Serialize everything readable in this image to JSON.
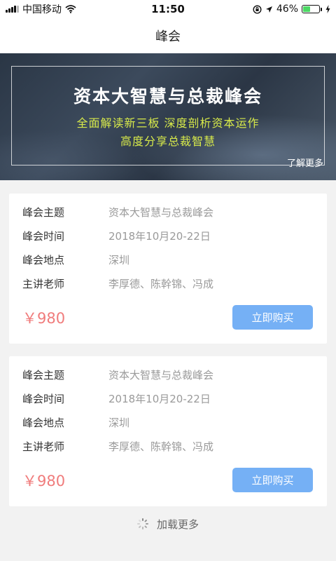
{
  "status_bar": {
    "carrier": "中国移动",
    "time": "11:50",
    "battery_percent": "46%",
    "battery_level": 0.46,
    "icons": [
      "signal-icon",
      "wifi-icon",
      "rotation-lock-icon",
      "location-icon",
      "battery-icon",
      "charging-icon"
    ]
  },
  "nav": {
    "title": "峰会"
  },
  "banner": {
    "title": "资本大智慧与总裁峰会",
    "subtitle_line1": "全面解读新三板  深度剖析资本运作",
    "subtitle_line2": "高度分享总裁智慧",
    "more_label": "了解更多",
    "accent_color": "#d7e94a"
  },
  "cards": [
    {
      "rows": [
        {
          "label": "峰会主题",
          "value": "资本大智慧与总裁峰会"
        },
        {
          "label": "峰会时间",
          "value": "2018年10月20-22日"
        },
        {
          "label": "峰会地点",
          "value": "深圳"
        },
        {
          "label": "主讲老师",
          "value": "李厚德、陈幹锦、冯成"
        }
      ],
      "price": "￥980",
      "buy_label": "立即购买"
    },
    {
      "rows": [
        {
          "label": "峰会主题",
          "value": "资本大智慧与总裁峰会"
        },
        {
          "label": "峰会时间",
          "value": "2018年10月20-22日"
        },
        {
          "label": "峰会地点",
          "value": "深圳"
        },
        {
          "label": "主讲老师",
          "value": "李厚德、陈幹锦、冯成"
        }
      ],
      "price": "￥980",
      "buy_label": "立即购买"
    }
  ],
  "load_more": {
    "label": "加载更多"
  },
  "colors": {
    "price": "#f07c7c",
    "button": "#75b0f5",
    "background": "#f2f2f2"
  }
}
